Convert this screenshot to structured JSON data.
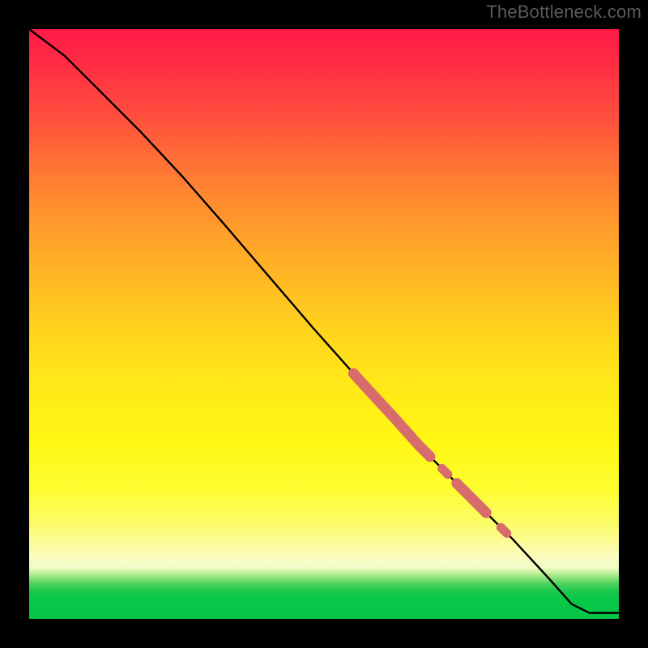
{
  "watermark": "TheBottleneck.com",
  "colors": {
    "line": "#000000",
    "marker": "#d86b6b",
    "gradient_top": "#ff1a47",
    "gradient_mid": "#ffe818",
    "gradient_bottom": "#05c647",
    "background": "#000000"
  },
  "chart_data": {
    "type": "line",
    "title": "",
    "xlabel": "",
    "ylabel": "",
    "xlim": [
      0,
      100
    ],
    "ylim": [
      0,
      100
    ],
    "grid": false,
    "legend": false,
    "series": [
      {
        "name": "curve",
        "x": [
          0,
          6,
          12,
          19,
          26,
          33,
          48,
          56,
          62,
          66,
          70,
          74,
          78,
          82,
          88,
          92,
          95,
          100
        ],
        "values": [
          100,
          95.5,
          89.5,
          82.5,
          75.0,
          67.0,
          49.5,
          40.5,
          34.0,
          29.5,
          25.5,
          21.5,
          17.5,
          13.5,
          7.0,
          2.5,
          1.0,
          1.0
        ]
      }
    ],
    "highlight_segments": [
      {
        "x_start": 55,
        "x_end": 68,
        "thick": true
      },
      {
        "x_start": 70,
        "x_end": 71,
        "thick": false
      },
      {
        "x_start": 72.5,
        "x_end": 77.5,
        "thick": true
      },
      {
        "x_start": 80,
        "x_end": 81,
        "thick": false
      }
    ],
    "annotations": []
  }
}
